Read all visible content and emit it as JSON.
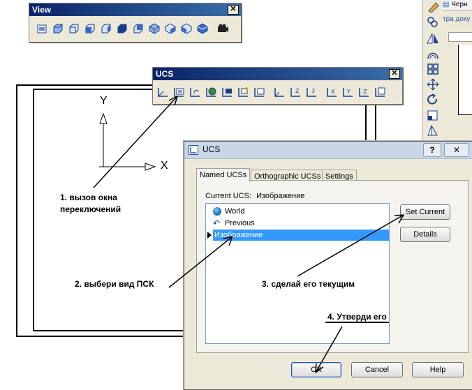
{
  "view_toolbar": {
    "title": "View",
    "close": "✕"
  },
  "ucs_toolbar": {
    "title": "UCS",
    "close": "✕"
  },
  "drawing": {
    "y_axis": "Y",
    "x_axis": "X"
  },
  "right_doc": {
    "tab_text": "Черн",
    "sub_text": "тра доку"
  },
  "dialog": {
    "title": "UCS",
    "help_btn": "?",
    "close_btn": "✕",
    "tabs": [
      "Named UCSs",
      "Orthographic UCSs",
      "Settings"
    ],
    "current_ucs_label": "Current UCS:",
    "current_ucs_value": "Изображение",
    "list": [
      {
        "label": "World",
        "icon": "globe-icon"
      },
      {
        "label": "Previous",
        "icon": "undo-arrow-icon"
      },
      {
        "label": "Изображение",
        "icon": "",
        "selected": true
      }
    ],
    "buttons": {
      "set_current": "Set Current",
      "details": "Details",
      "ok": "OK",
      "cancel": "Cancel",
      "help": "Help"
    }
  },
  "annotations": {
    "a1_line1": "1. вызов окна",
    "a1_line2": "переключений",
    "a2": "2. выбери вид ПСК",
    "a3": "3. сделай его текущим",
    "a4": "4. Утверди его"
  },
  "colors": {
    "title_bar": "#0a246a",
    "selection": "#3399ff",
    "toolbar_bg": "#ece9d8"
  }
}
